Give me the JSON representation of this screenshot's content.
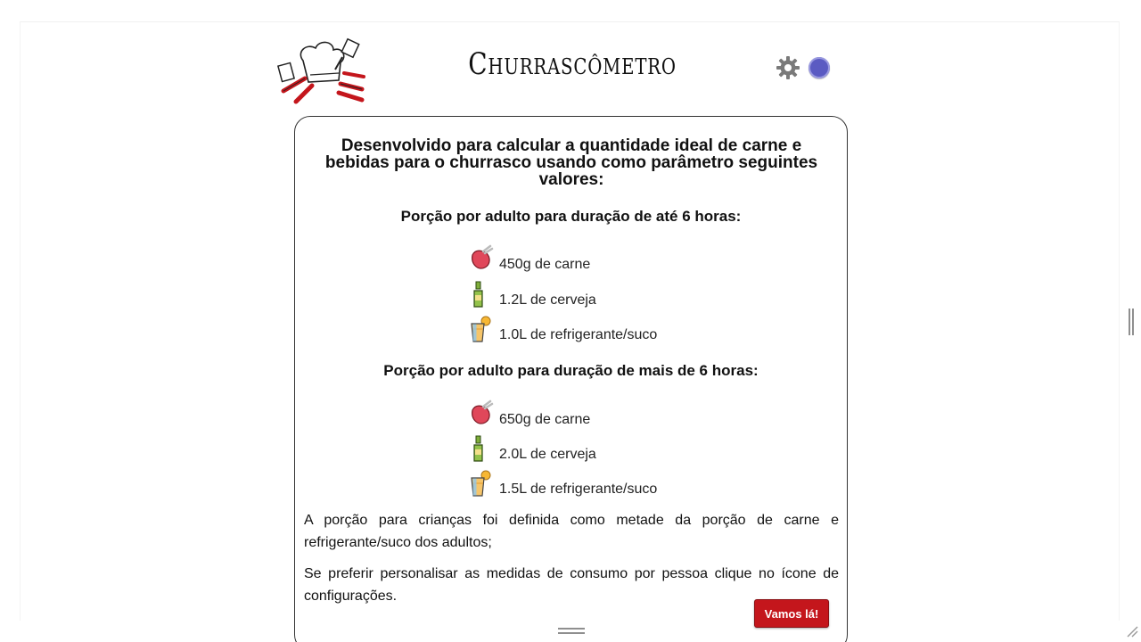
{
  "header": {
    "title": "Churrascômetro",
    "settings_icon": "gear-icon",
    "theme_icon": "theme-toggle-icon",
    "logo_icon": "bbq-chef-logo"
  },
  "card": {
    "intro": "Desenvolvido para calcular a quantidade ideal de carne e bebidas para o churrasco usando como parâmetro seguintes valores:",
    "sections": [
      {
        "title": "Porção por adulto para duração de até 6 horas:",
        "items": [
          {
            "icon": "meat-icon",
            "text": "450g de carne"
          },
          {
            "icon": "beer-bottle-icon",
            "text": "1.2L de cerveja"
          },
          {
            "icon": "juice-glass-icon",
            "text": "1.0L de refrigerante/suco"
          }
        ]
      },
      {
        "title": "Porção por adulto para duração de mais de 6 horas:",
        "items": [
          {
            "icon": "meat-icon",
            "text": "650g de carne"
          },
          {
            "icon": "beer-bottle-icon",
            "text": "2.0L de cerveja"
          },
          {
            "icon": "juice-glass-icon",
            "text": "1.5L de refrigerante/suco"
          }
        ]
      }
    ],
    "notes": [
      "A porção para crianças foi definida como metade da porção de carne e refrigerante/suco dos adultos;",
      "Se preferir personalisar as medidas de consumo por pessoa clique no ícone de configurações."
    ],
    "cta_label": "Vamos lá!"
  },
  "colors": {
    "accent": "#c4161c",
    "theme_toggle": "#5b5bc2"
  }
}
